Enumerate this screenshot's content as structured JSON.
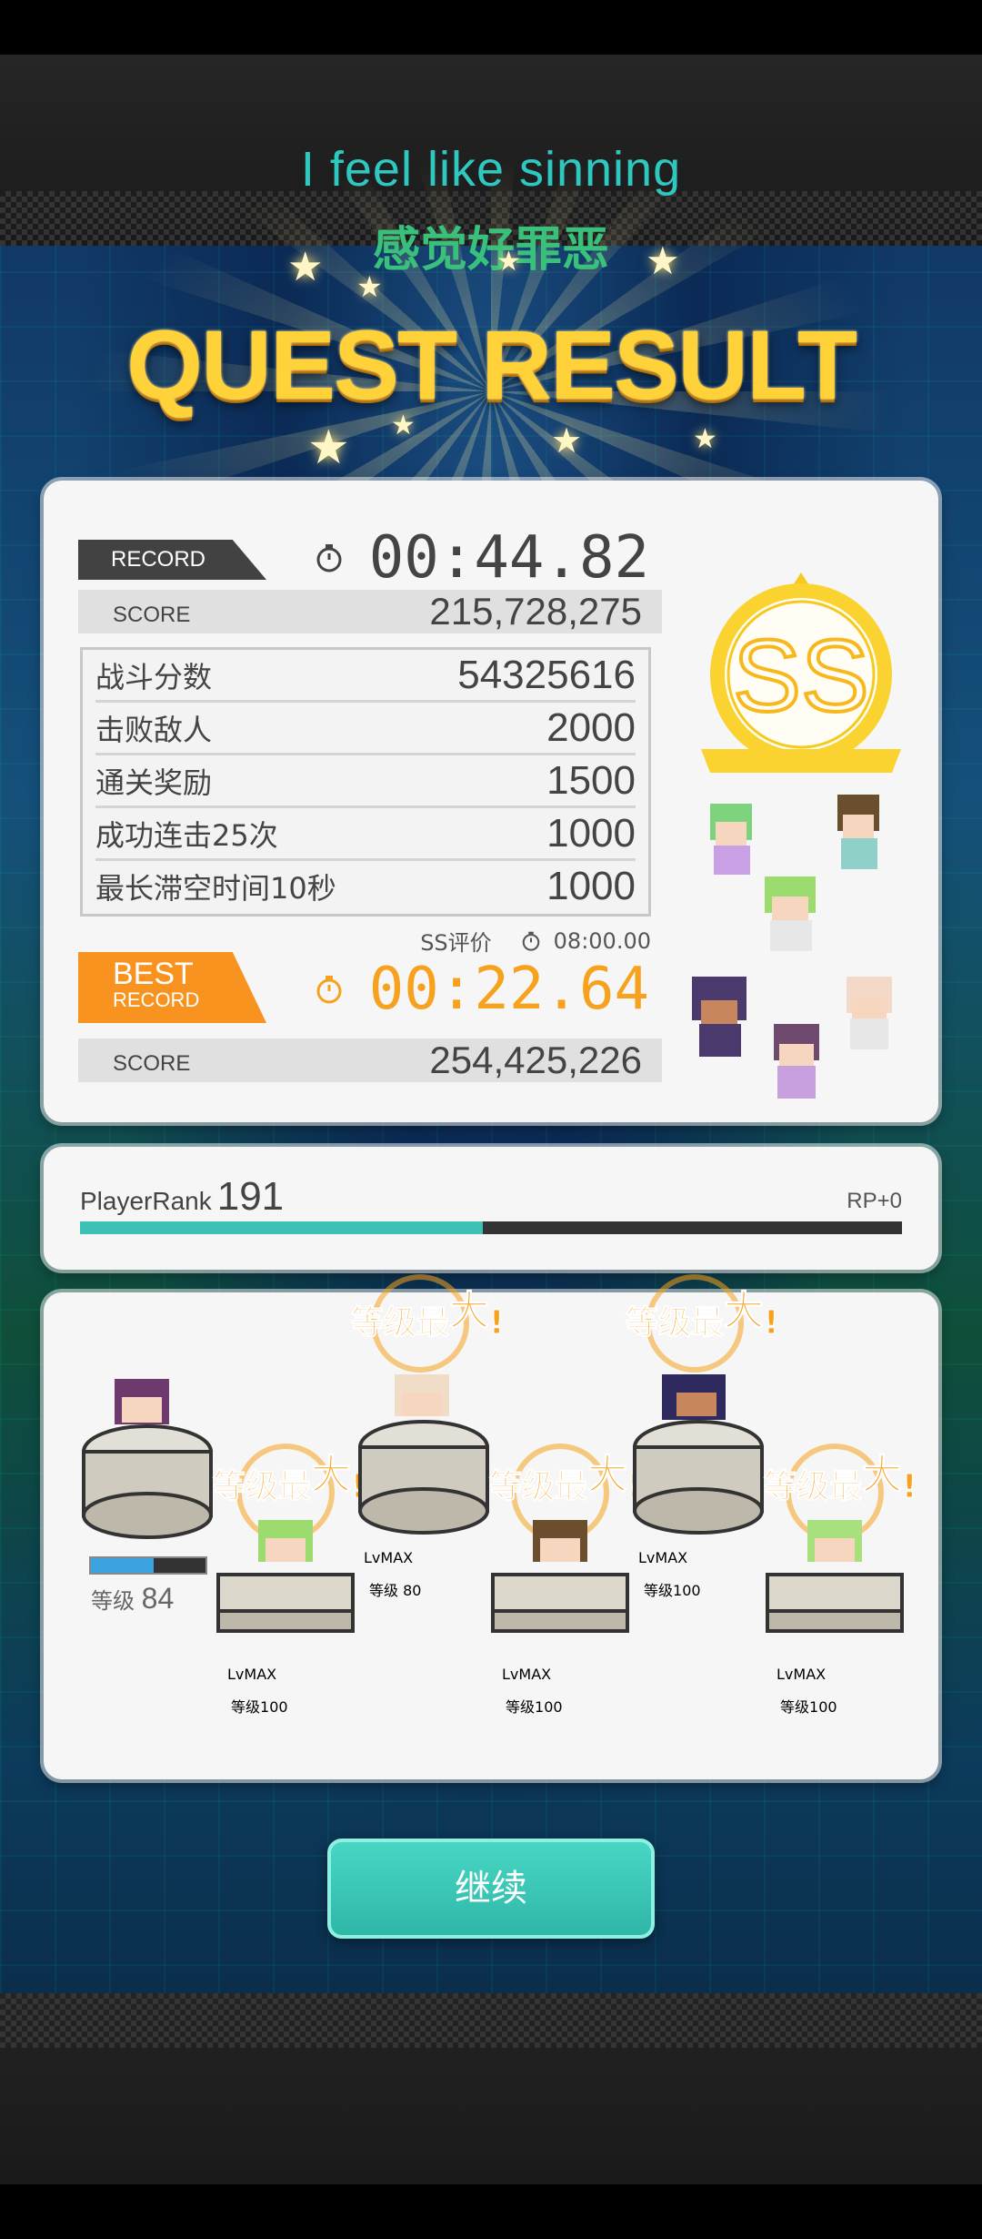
{
  "song": {
    "title_en": "I feel like sinning",
    "title_cn": "感觉好罪恶"
  },
  "header": {
    "title": "QUEST RESULT"
  },
  "record": {
    "tag_label": "RECORD",
    "time": "00:44.82",
    "score_label": "SCORE",
    "score": "215,728,275"
  },
  "details": [
    {
      "label": "战斗分数",
      "value": "54325616"
    },
    {
      "label": "击败敌人",
      "value": "2000"
    },
    {
      "label": "通关奖励",
      "value": "1500"
    },
    {
      "label": "成功连击25次",
      "value": "1000"
    },
    {
      "label": "最长滞空时间10秒",
      "value": "1000"
    }
  ],
  "ss_requirement": {
    "label": "SS评价",
    "time": "08:00.00"
  },
  "best": {
    "tag_line1": "BEST",
    "tag_line2": "RECORD",
    "time": "00:22.64",
    "score_label": "SCORE",
    "score": "254,425,226"
  },
  "rank_grade": "SS",
  "player": {
    "rank_label": "PlayerRank",
    "rank": "191",
    "rp": "RP+0",
    "progress": 0.49
  },
  "units": {
    "max_label_prefix": "等级最",
    "max_label_big": "大",
    "max_label_suffix": "!",
    "lvmax_label": "LvMAX",
    "level_prefix": "等级",
    "u1_level": "84",
    "u2_level": "100",
    "u3_level": "80",
    "u4_level": "100",
    "u5_level": "100",
    "u6_level": "100",
    "u1_exp": 0.55
  },
  "actions": {
    "continue": "继续"
  },
  "colors": {
    "accent_teal": "#3cc1b4",
    "accent_orange": "#f7931e",
    "title_gold": "#ffd23a"
  }
}
